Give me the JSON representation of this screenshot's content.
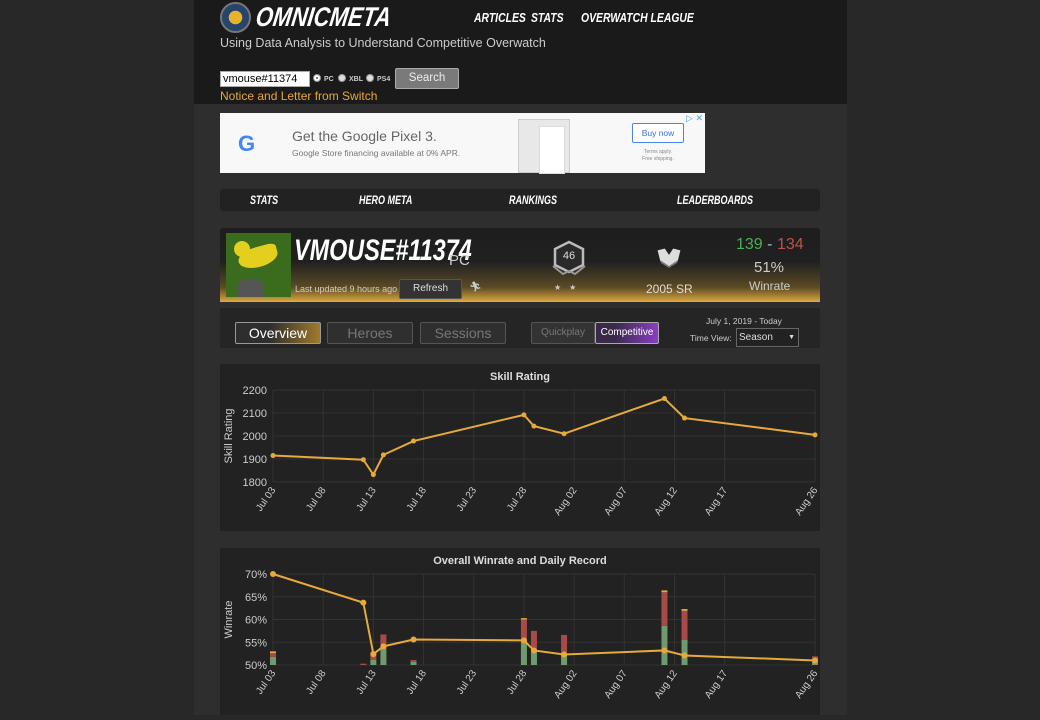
{
  "header": {
    "brand": "OMNICMETA",
    "tagline": "Using Data Analysis to Understand Competitive Overwatch",
    "nav": [
      "ARTICLES",
      "STATS",
      "OVERWATCH LEAGUE"
    ],
    "search": {
      "value": "vmouse#11374",
      "platforms": [
        {
          "label": "PC",
          "selected": true
        },
        {
          "label": "XBL",
          "selected": false
        },
        {
          "label": "PS4",
          "selected": false
        }
      ],
      "button_label": "Search"
    },
    "notice_link": "Notice and Letter from Switch"
  },
  "ad": {
    "logo": "G",
    "title": "Get the Google Pixel 3.",
    "subtitle": "Google Store financing available at 0% APR.",
    "button_label": "Buy now",
    "terms_line1": "Terms apply.",
    "terms_line2": "Free shipping.",
    "close": "▷ ✕"
  },
  "subnav": [
    "STATS",
    "HERO META",
    "RANKINGS",
    "LEADERBOARDS"
  ],
  "profile": {
    "name": "VMOUSE#11374",
    "platform": "PC",
    "last_updated": "Last updated 9 hours ago",
    "refresh_label": "Refresh",
    "level": "46",
    "stars": "★★",
    "sr": "2005 SR",
    "wins": "139",
    "losses": "134",
    "dash": "-",
    "winrate": "51%",
    "winrate_label": "Winrate",
    "colors": {
      "wins": "#4caf50",
      "losses": "#c0504d",
      "accent": "#e7ad3b"
    }
  },
  "tabs": [
    {
      "label": "Overview",
      "active": true
    },
    {
      "label": "Heroes",
      "active": false
    },
    {
      "label": "Sessions",
      "active": false
    }
  ],
  "modes": [
    {
      "label": "Quickplay",
      "active": false
    },
    {
      "label": "Competitive",
      "active": true
    }
  ],
  "time_view": {
    "date_range": "July 1, 2019 - Today",
    "label": "Time View:",
    "selected": "Season"
  },
  "chart_data": [
    {
      "type": "line",
      "title": "Skill Rating",
      "xlabel": "",
      "ylabel": "Skill Rating",
      "ylim": [
        1800,
        2200
      ],
      "yticks": [
        "2200",
        "2100",
        "2000",
        "1900",
        "1800"
      ],
      "xtick_labels": [
        "Jul 03",
        "Jul 08",
        "Jul 13",
        "Jul 18",
        "Jul 23",
        "Jul 28",
        "Aug 02",
        "Aug 07",
        "Aug 12",
        "Aug 17",
        "Aug 26"
      ],
      "xtick_days": [
        2,
        7,
        12,
        17,
        22,
        27,
        32,
        37,
        42,
        47,
        56
      ],
      "xlim_days": [
        2,
        56
      ],
      "grid": true,
      "line_color": "#e7a93a",
      "points": [
        {
          "date": "Jul 03",
          "day": 2,
          "value": 1915
        },
        {
          "date": "Jul 12",
          "day": 11,
          "value": 1897
        },
        {
          "date": "Jul 13",
          "day": 12,
          "value": 1832
        },
        {
          "date": "Jul 14",
          "day": 13,
          "value": 1918
        },
        {
          "date": "Jul 17",
          "day": 16,
          "value": 1978
        },
        {
          "date": "Jul 28",
          "day": 27,
          "value": 2092
        },
        {
          "date": "Jul 29",
          "day": 28,
          "value": 2043
        },
        {
          "date": "Aug 01",
          "day": 31,
          "value": 2010
        },
        {
          "date": "Aug 11",
          "day": 41,
          "value": 2163
        },
        {
          "date": "Aug 13",
          "day": 43,
          "value": 2078
        },
        {
          "date": "Aug 26",
          "day": 56,
          "value": 2005
        }
      ]
    },
    {
      "type": "bar+line",
      "title": "Overall Winrate and Daily Record",
      "xlabel": "",
      "ylabel": "Winrate",
      "ylim": [
        50,
        70
      ],
      "yticks": [
        "70%",
        "65%",
        "60%",
        "55%",
        "50%"
      ],
      "xtick_labels": [
        "Jul 03",
        "Jul 08",
        "Jul 13",
        "Jul 18",
        "Jul 23",
        "Jul 28",
        "Aug 02",
        "Aug 07",
        "Aug 12",
        "Aug 17",
        "Aug 26"
      ],
      "xtick_days": [
        2,
        7,
        12,
        17,
        22,
        27,
        32,
        37,
        42,
        47,
        56
      ],
      "xlim_days": [
        2,
        56
      ],
      "grid": true,
      "colors": {
        "line": "#e7a93a",
        "wins": "#6e9a6e",
        "losses": "#a84a47",
        "draws": "#e7a93a"
      },
      "bar_units_note": "bar heights in winrate-axis units above 50%",
      "line_points": [
        {
          "date": "Jul 03",
          "day": 2,
          "value": 70.0
        },
        {
          "date": "Jul 12",
          "day": 11,
          "value": 63.7
        },
        {
          "date": "Jul 13",
          "day": 12,
          "value": 52.4
        },
        {
          "date": "Jul 14",
          "day": 13,
          "value": 54.1
        },
        {
          "date": "Jul 17",
          "day": 16,
          "value": 55.6
        },
        {
          "date": "Jul 28",
          "day": 27,
          "value": 55.4
        },
        {
          "date": "Jul 29",
          "day": 28,
          "value": 53.2
        },
        {
          "date": "Aug 01",
          "day": 31,
          "value": 52.3
        },
        {
          "date": "Aug 11",
          "day": 41,
          "value": 53.2
        },
        {
          "date": "Aug 13",
          "day": 43,
          "value": 52.1
        },
        {
          "date": "Aug 26",
          "day": 56,
          "value": 51.0
        }
      ],
      "bars": [
        {
          "date": "Jul 03",
          "day": 2,
          "wins": 1.8,
          "losses": 0.8,
          "draws": 0.4
        },
        {
          "date": "Jul 12",
          "day": 11,
          "wins": 0,
          "losses": 0.3,
          "draws": 0
        },
        {
          "date": "Jul 13",
          "day": 12,
          "wins": 1.1,
          "losses": 1.8,
          "draws": 0
        },
        {
          "date": "Jul 14",
          "day": 13,
          "wins": 4.1,
          "losses": 2.6,
          "draws": 0
        },
        {
          "date": "Jul 17",
          "day": 16,
          "wins": 0.7,
          "losses": 0.4,
          "draws": 0
        },
        {
          "date": "Jul 28",
          "day": 27,
          "wins": 5.2,
          "losses": 4.8,
          "draws": 0.3
        },
        {
          "date": "Jul 29",
          "day": 28,
          "wins": 3.2,
          "losses": 4.3,
          "draws": 0
        },
        {
          "date": "Aug 01",
          "day": 31,
          "wins": 2.2,
          "losses": 4.4,
          "draws": 0
        },
        {
          "date": "Aug 11",
          "day": 41,
          "wins": 8.6,
          "losses": 7.4,
          "draws": 0.4
        },
        {
          "date": "Aug 13",
          "day": 43,
          "wins": 5.5,
          "losses": 6.4,
          "draws": 0.4
        },
        {
          "date": "Aug 26",
          "day": 56,
          "wins": 0.7,
          "losses": 1.2,
          "draws": 0
        }
      ]
    }
  ]
}
